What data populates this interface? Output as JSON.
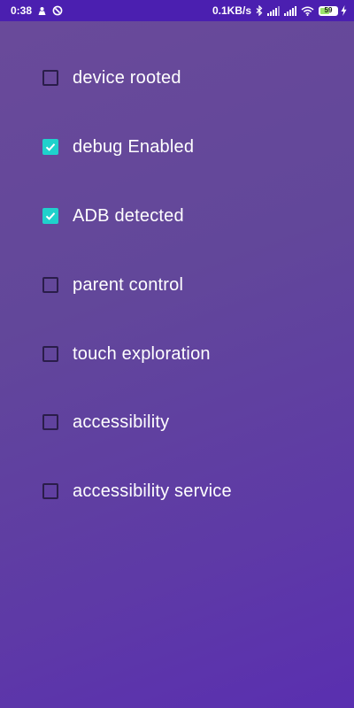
{
  "status_bar": {
    "time": "0:38",
    "network_speed": "0.1KB/s",
    "battery_level": "59",
    "battery_fraction": 0.59,
    "left_icons": [
      "notification-icon",
      "dnd-icon"
    ],
    "right_icons": [
      "bluetooth-icon",
      "signal-icon",
      "signal-icon",
      "wifi-icon",
      "battery-icon",
      "charging-icon"
    ]
  },
  "colors": {
    "status_bar_bg": "#4b1fb0",
    "background": "#62479a",
    "checkbox_checked": "#1fd1cc",
    "checkbox_unchecked_border": "#2a1d4a",
    "text": "#ffffff"
  },
  "items": [
    {
      "label": "device rooted",
      "checked": false
    },
    {
      "label": "debug Enabled",
      "checked": true
    },
    {
      "label": "ADB detected",
      "checked": true
    },
    {
      "label": "parent control",
      "checked": false
    },
    {
      "label": "touch exploration",
      "checked": false
    },
    {
      "label": "accessibility",
      "checked": false
    },
    {
      "label": "accessibility service",
      "checked": false
    }
  ]
}
